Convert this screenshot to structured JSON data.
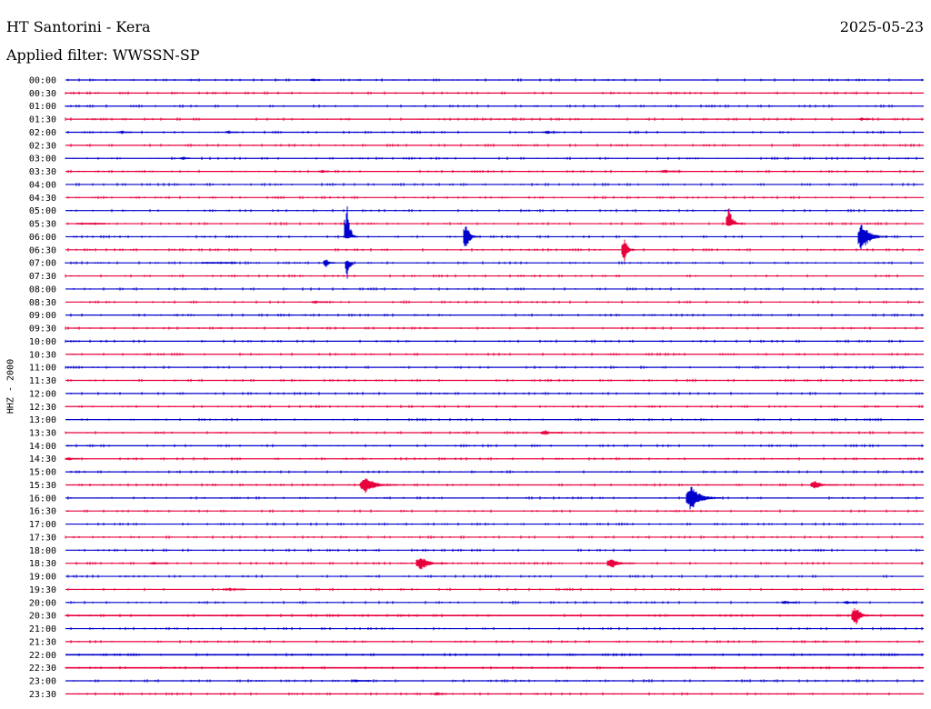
{
  "header": {
    "title": "HT Santorini - Kera",
    "date": "2025-05-23",
    "filter": "Applied filter: WWSSN-SP"
  },
  "channel_label": "HHZ - 2000",
  "colors": {
    "blue": "#0000cc",
    "red": "#e8003c"
  },
  "traces": [
    {
      "time": "00:00",
      "color": "blue",
      "events": []
    },
    {
      "time": "00:30",
      "color": "red",
      "events": []
    },
    {
      "time": "01:00",
      "color": "blue",
      "events": []
    },
    {
      "time": "01:30",
      "color": "red",
      "events": []
    },
    {
      "time": "02:00",
      "color": "blue",
      "events": []
    },
    {
      "time": "02:30",
      "color": "red",
      "events": []
    },
    {
      "time": "03:00",
      "color": "blue",
      "events": []
    },
    {
      "time": "03:30",
      "color": "red",
      "events": []
    },
    {
      "time": "04:00",
      "color": "blue",
      "events": []
    },
    {
      "time": "04:30",
      "color": "red",
      "events": []
    },
    {
      "time": "05:00",
      "color": "blue",
      "events": []
    },
    {
      "time": "05:30",
      "color": "red",
      "events": []
    },
    {
      "time": "06:00",
      "color": "blue",
      "events": []
    },
    {
      "time": "06:30",
      "color": "red",
      "events": []
    },
    {
      "time": "07:00",
      "color": "blue",
      "events": []
    },
    {
      "time": "07:30",
      "color": "red",
      "events": []
    },
    {
      "time": "08:00",
      "color": "blue",
      "events": []
    },
    {
      "time": "08:30",
      "color": "red",
      "events": []
    },
    {
      "time": "09:00",
      "color": "blue",
      "events": []
    },
    {
      "time": "09:30",
      "color": "red",
      "events": []
    },
    {
      "time": "10:00",
      "color": "blue",
      "events": []
    },
    {
      "time": "10:30",
      "color": "red",
      "events": []
    },
    {
      "time": "11:00",
      "color": "blue",
      "events": []
    },
    {
      "time": "11:30",
      "color": "red",
      "events": []
    },
    {
      "time": "12:00",
      "color": "blue",
      "events": []
    },
    {
      "time": "12:30",
      "color": "red",
      "events": []
    },
    {
      "time": "13:00",
      "color": "blue",
      "events": []
    },
    {
      "time": "13:30",
      "color": "red",
      "events": []
    },
    {
      "time": "14:00",
      "color": "blue",
      "events": []
    },
    {
      "time": "14:30",
      "color": "red",
      "events": []
    },
    {
      "time": "15:00",
      "color": "blue",
      "events": []
    },
    {
      "time": "15:30",
      "color": "red",
      "events": []
    },
    {
      "time": "16:00",
      "color": "blue",
      "events": []
    },
    {
      "time": "16:30",
      "color": "red",
      "events": []
    },
    {
      "time": "17:00",
      "color": "blue",
      "events": []
    },
    {
      "time": "17:30",
      "color": "red",
      "events": []
    },
    {
      "time": "18:00",
      "color": "blue",
      "events": []
    },
    {
      "time": "18:30",
      "color": "red",
      "events": []
    },
    {
      "time": "19:00",
      "color": "blue",
      "events": []
    },
    {
      "time": "19:30",
      "color": "red",
      "events": []
    },
    {
      "time": "20:00",
      "color": "blue",
      "events": []
    },
    {
      "time": "20:30",
      "color": "red",
      "events": []
    },
    {
      "time": "21:00",
      "color": "blue",
      "events": []
    },
    {
      "time": "21:30",
      "color": "red",
      "events": []
    },
    {
      "time": "22:00",
      "color": "blue",
      "events": []
    },
    {
      "time": "22:30",
      "color": "red",
      "events": []
    },
    {
      "time": "23:00",
      "color": "blue",
      "events": []
    },
    {
      "time": "23:30",
      "color": "red",
      "events": []
    }
  ]
}
